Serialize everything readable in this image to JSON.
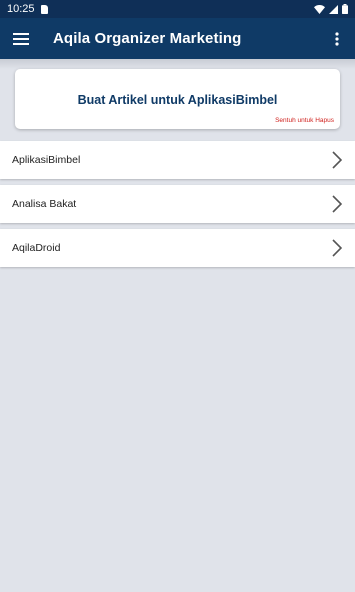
{
  "status_bar": {
    "time": "10:25"
  },
  "app_bar": {
    "title": "Aqila Organizer Marketing"
  },
  "article_card": {
    "title": "Buat Artikel untuk AplikasiBimbel",
    "hint": "Sentuh untuk Hapus"
  },
  "list": {
    "items": [
      {
        "label": "AplikasiBimbel"
      },
      {
        "label": "Analisa Bakat"
      },
      {
        "label": "AqilaDroid"
      }
    ]
  },
  "colors": {
    "primary": "#0f3a66",
    "status_bar": "#0f2f57",
    "hint": "#d0231f",
    "background": "#e0e3ea"
  }
}
